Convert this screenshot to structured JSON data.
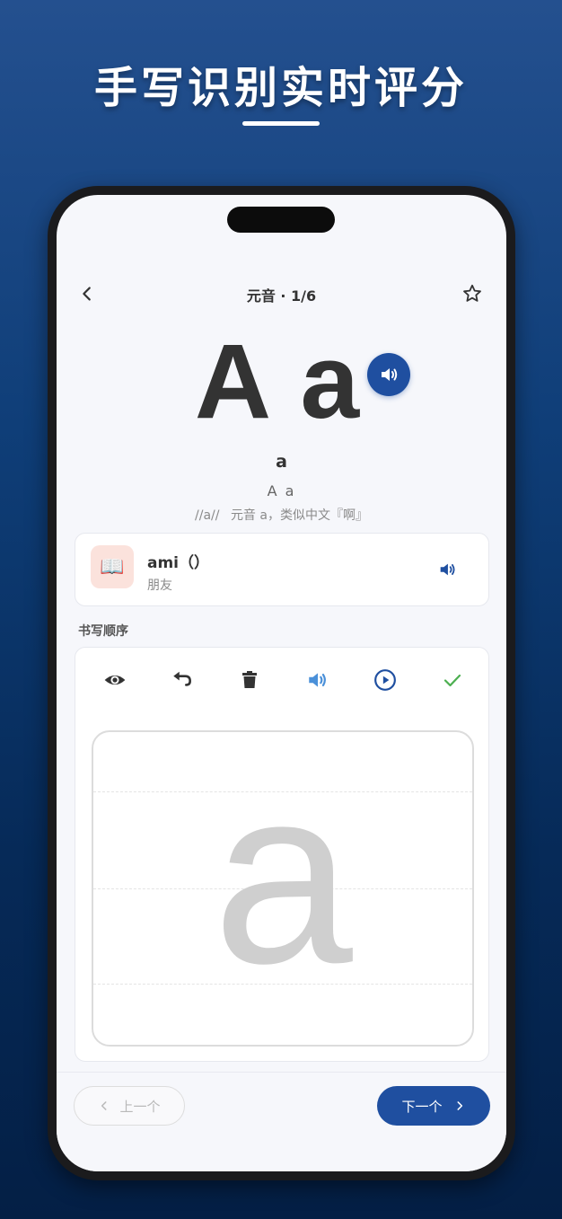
{
  "promo": {
    "headline": "手写识别实时评分"
  },
  "header": {
    "title": "元音 · 1/6",
    "back_icon": "chevron-left-icon",
    "favorite_icon": "star-outline-icon"
  },
  "letter": {
    "display": "A a",
    "name": "a",
    "pair": "A a",
    "phonetic": "//a//",
    "description": "元音 a，类似中文『啊』"
  },
  "example_word": {
    "icon": "📖",
    "word": "ami（）",
    "meaning": "朋友"
  },
  "writing": {
    "section_label": "书写顺序",
    "tools": [
      "eye-icon",
      "undo-icon",
      "trash-icon",
      "speaker-icon",
      "play-circle-icon",
      "check-icon"
    ],
    "guide_letter": "a"
  },
  "navigation": {
    "prev_label": "上一个",
    "next_label": "下一个"
  },
  "colors": {
    "primary": "#1f4fa0",
    "check": "#4caf50",
    "speaker_light": "#4a90d9"
  }
}
